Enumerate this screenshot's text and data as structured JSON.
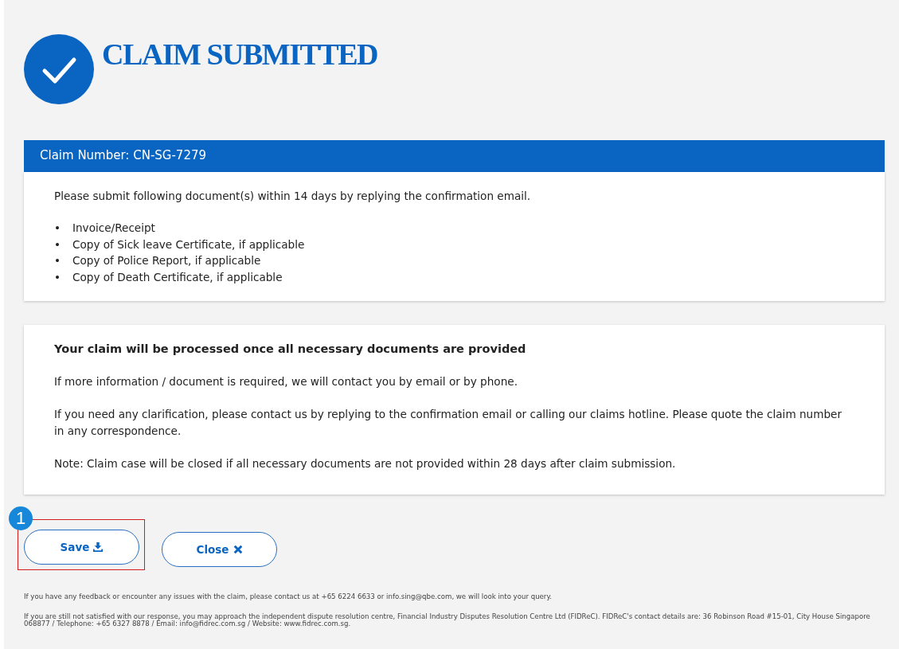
{
  "title": "CLAIM SUBMITTED",
  "claim_header": "Claim Number: CN-SG-7279",
  "documents": {
    "intro": "Please submit following document(s) within 14 days by replying the confirmation email.",
    "bullet": "•",
    "items": [
      "Invoice/Receipt",
      "Copy of Sick leave Certificate, if applicable",
      "Copy of Police Report, if applicable",
      "Copy of Death Certificate, if applicable"
    ]
  },
  "processing": {
    "heading": "Your claim will be processed once all necessary documents are provided",
    "paragraphs": [
      "If more information / document is required, we will contact you by email or by phone.",
      "If you need any clarification, please contact us by replying to the confirmation email or calling our claims hotline. Please quote the claim number in any correspondence.",
      "Note: Claim case will be closed if all necessary documents are not provided within 28 days after claim submission."
    ]
  },
  "buttons": [
    {
      "label": "Save",
      "kind": "save",
      "highlighted": true
    },
    {
      "label": "Close",
      "kind": "close",
      "highlighted": false
    }
  ],
  "annotation": "1",
  "footer": [
    "If you have any feedback or encounter any issues with the claim, please contact us at +65 6224 6633 or info.sing@qbe.com, we will look into your query.",
    "If you are still not satisfied with our response, you may approach the independent dispute resolution centre, Financial Industry Disputes Resolution Centre Ltd (FIDReC). FIDReC's contact details are: 36 Robinson Road #15-01, City House Singapore 068877 / Telephone: +65 6327 8878 / Email: info@fidrec.com.sg / Website: www.fidrec.com.sg."
  ]
}
